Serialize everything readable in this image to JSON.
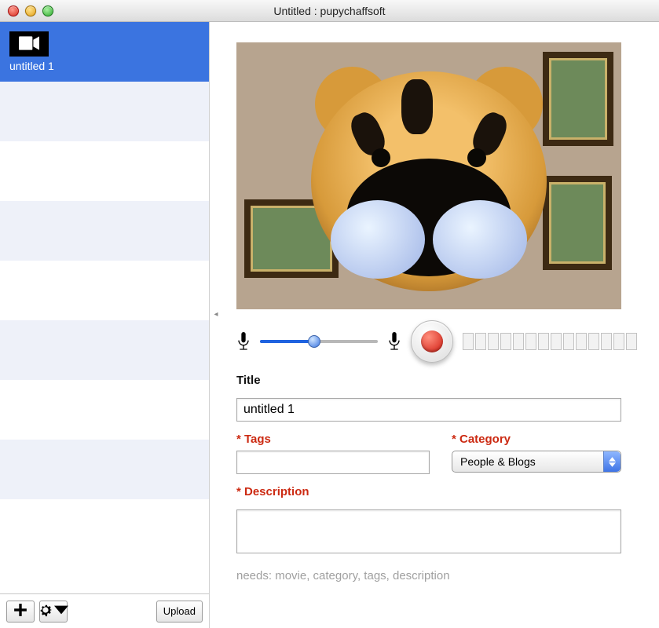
{
  "window": {
    "title": "Untitled : pupychaffsoft"
  },
  "sidebar": {
    "items": [
      {
        "label": "untitled 1",
        "selected": true
      }
    ]
  },
  "toolbar": {
    "add_label": "+",
    "upload_label": "Upload"
  },
  "controls": {
    "mic_level_percent": 46,
    "segment_count": 14
  },
  "form": {
    "title_label": "Title",
    "title_value": "untitled 1",
    "tags_label": "* Tags",
    "tags_value": "",
    "category_label": "* Category",
    "category_value": "People & Blogs",
    "description_label": "* Description",
    "description_value": "",
    "hint": "needs: movie, category, tags, description"
  }
}
